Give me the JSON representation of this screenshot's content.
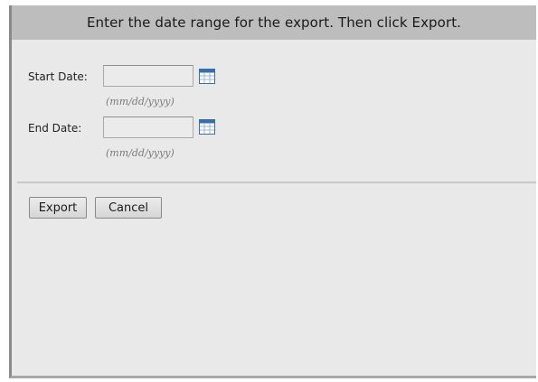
{
  "header": {
    "instruction": "Enter the date range for the export. Then click Export."
  },
  "form": {
    "start_date": {
      "label": "Start Date:",
      "value": "",
      "placeholder": "",
      "format_hint": "(mm/dd/yyyy)",
      "picker_icon": "calendar-icon"
    },
    "end_date": {
      "label": "End Date:",
      "value": "",
      "placeholder": "",
      "format_hint": "(mm/dd/yyyy)",
      "picker_icon": "calendar-icon"
    }
  },
  "actions": {
    "export_label": "Export",
    "cancel_label": "Cancel"
  },
  "colors": {
    "header_background": "#bdbdbd",
    "panel_background": "#e9e9e9",
    "calendar_icon_accent": "#3a6ea5"
  }
}
